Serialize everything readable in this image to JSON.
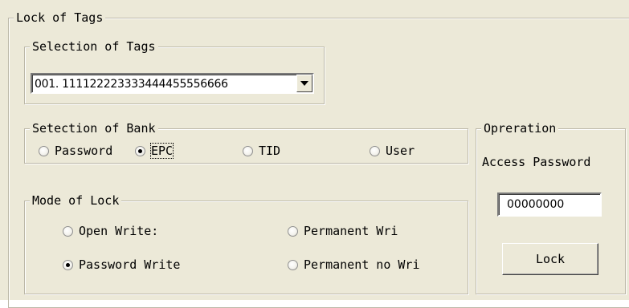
{
  "lock_group": {
    "legend": "Lock of Tags"
  },
  "selection_group": {
    "legend": "Selection of Tags",
    "selected_tag": "001. 111122223333444455556666"
  },
  "bank_group": {
    "legend": "Setection of Bank",
    "options": [
      "Password",
      "EPC",
      "TID",
      "User"
    ],
    "selected": "EPC"
  },
  "mode_group": {
    "legend": "Mode of Lock",
    "options": [
      "Open Write:",
      "Permanent Wri",
      "Password Write",
      "Permanent no Wri"
    ],
    "selected": "Password Write"
  },
  "operation_group": {
    "legend": "Opreration",
    "access_label": "Access Password",
    "access_value": "00000000",
    "lock_button": "Lock"
  },
  "icons": {
    "dropdown": "chevron-down-icon"
  }
}
